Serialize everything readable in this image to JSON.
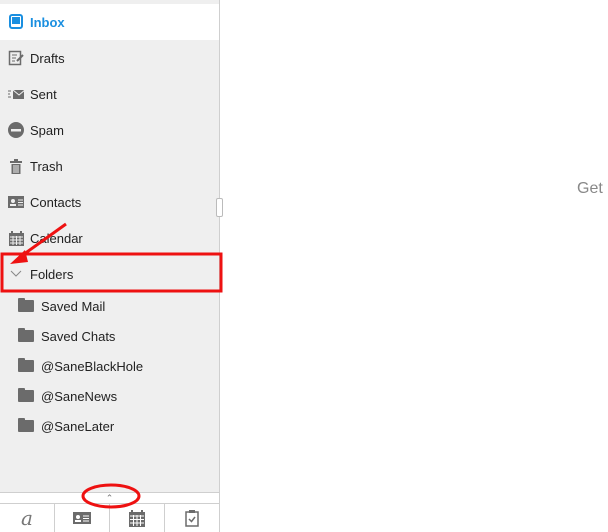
{
  "sidebar": {
    "items": [
      {
        "label": "Inbox",
        "icon": "inbox-icon",
        "active": true
      },
      {
        "label": "Drafts",
        "icon": "drafts-icon"
      },
      {
        "label": "Sent",
        "icon": "sent-icon"
      },
      {
        "label": "Spam",
        "icon": "spam-icon"
      },
      {
        "label": "Trash",
        "icon": "trash-icon"
      },
      {
        "label": "Contacts",
        "icon": "contacts-icon"
      },
      {
        "label": "Calendar",
        "icon": "calendar-icon"
      },
      {
        "label": "Folders",
        "icon": "chevron-down-icon"
      }
    ],
    "folders": [
      "Saved Mail",
      "Saved Chats",
      "@SaneBlackHole",
      "@SaneNews",
      "@SaneLater"
    ],
    "collapse_icon": "chevron-up-icon",
    "bottom_tabs": [
      "mail-app-icon",
      "contacts-icon",
      "calendar-icon",
      "tasks-icon"
    ]
  },
  "main": {
    "text": "Get"
  },
  "colors": {
    "accent": "#1a8fe0",
    "annotation": "#ee1111"
  }
}
